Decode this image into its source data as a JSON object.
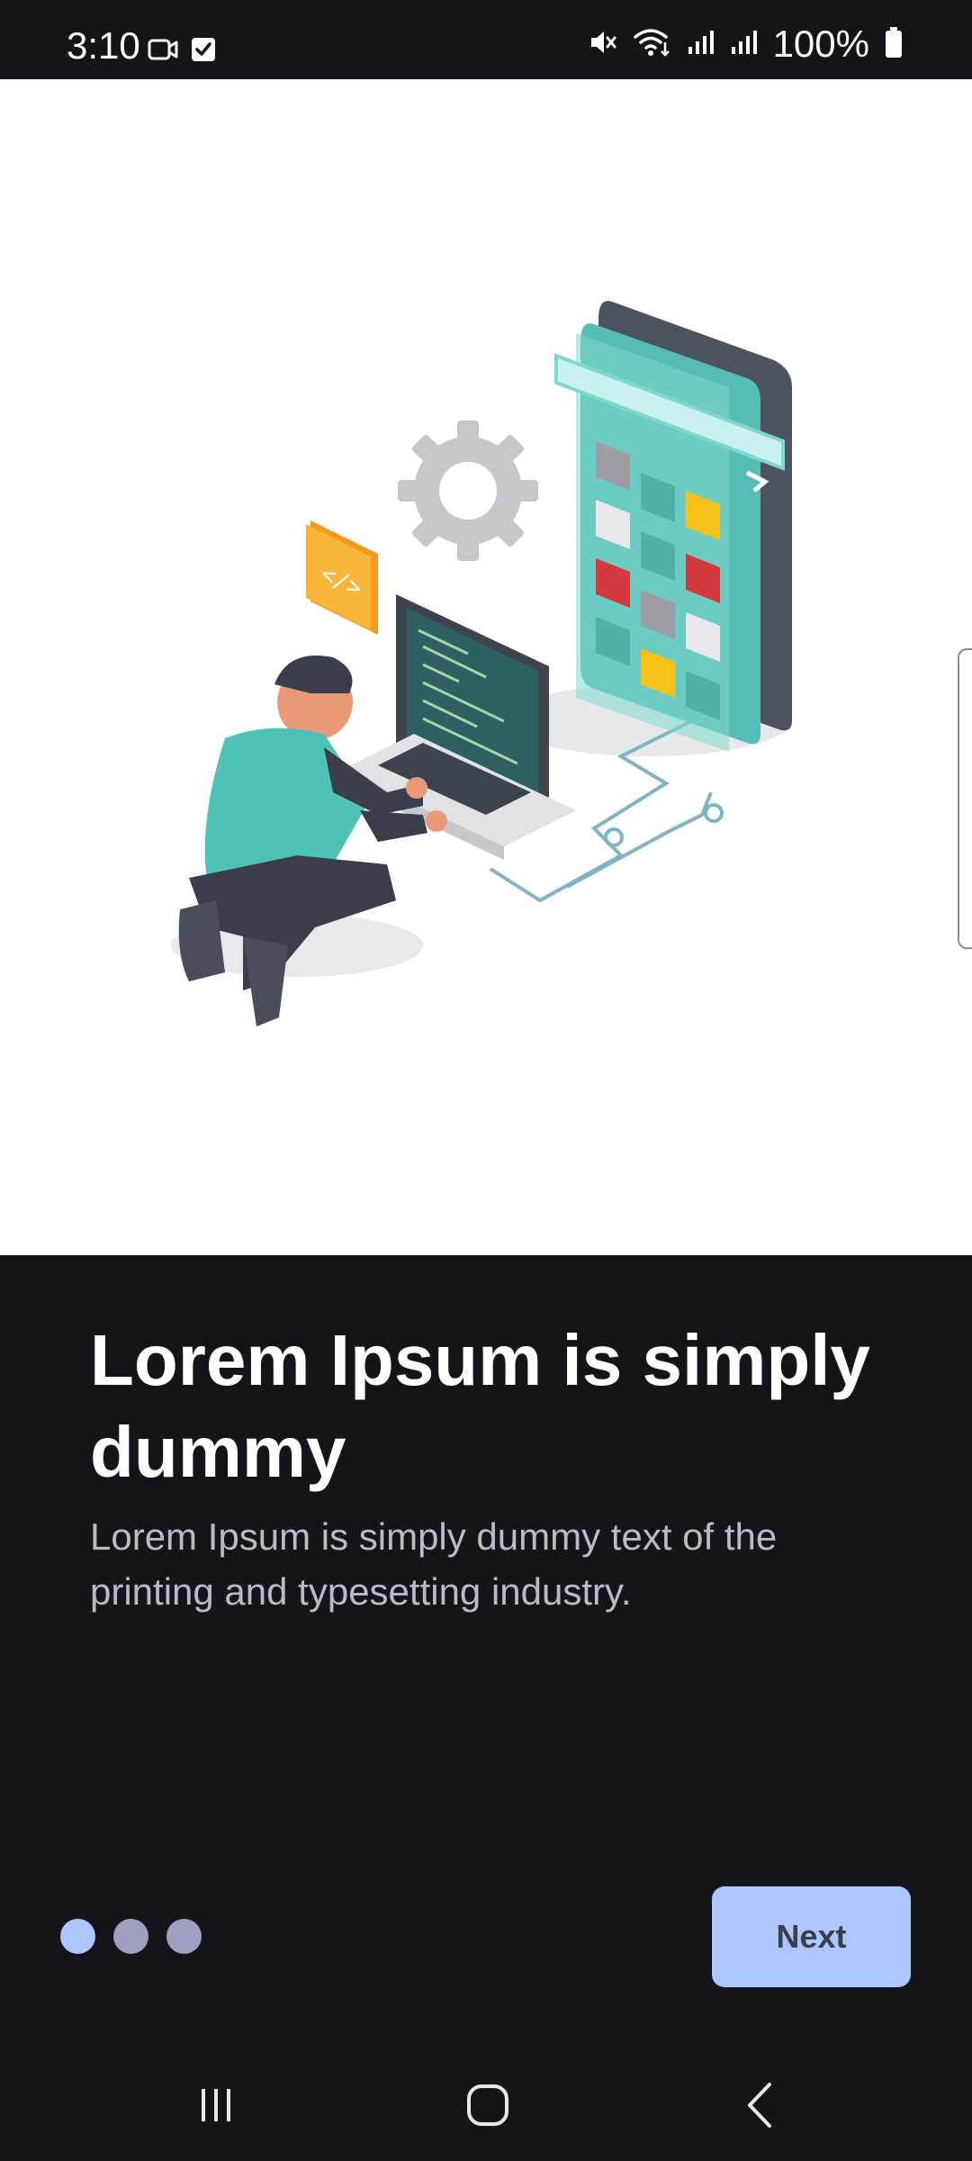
{
  "status_bar": {
    "time": "3:10",
    "battery_text": "100%",
    "left_icons": [
      "video-call-icon",
      "checkbox-icon"
    ],
    "right_icons": [
      "mute-icon",
      "wifi-icon",
      "signal-icon",
      "signal-icon",
      "battery-icon"
    ]
  },
  "onboarding": {
    "illustration": "developer-coding-isometric-illustration",
    "title": "Lorem Ipsum is simply dummy",
    "description": "Lorem Ipsum is simply dummy text of the printing and typesetting industry.",
    "page_indicator": {
      "total": 3,
      "current": 1
    },
    "next_label": "Next"
  },
  "navigation_bar": {
    "icons": [
      "recent-apps-icon",
      "home-icon",
      "back-icon"
    ]
  },
  "colors": {
    "background": "#14151a",
    "accent": "#aec6ff",
    "inactive_dot": "#9ea0bf",
    "title_text": "#ffffff",
    "body_text": "#b9bcc5",
    "button_text": "#3b3e49"
  }
}
